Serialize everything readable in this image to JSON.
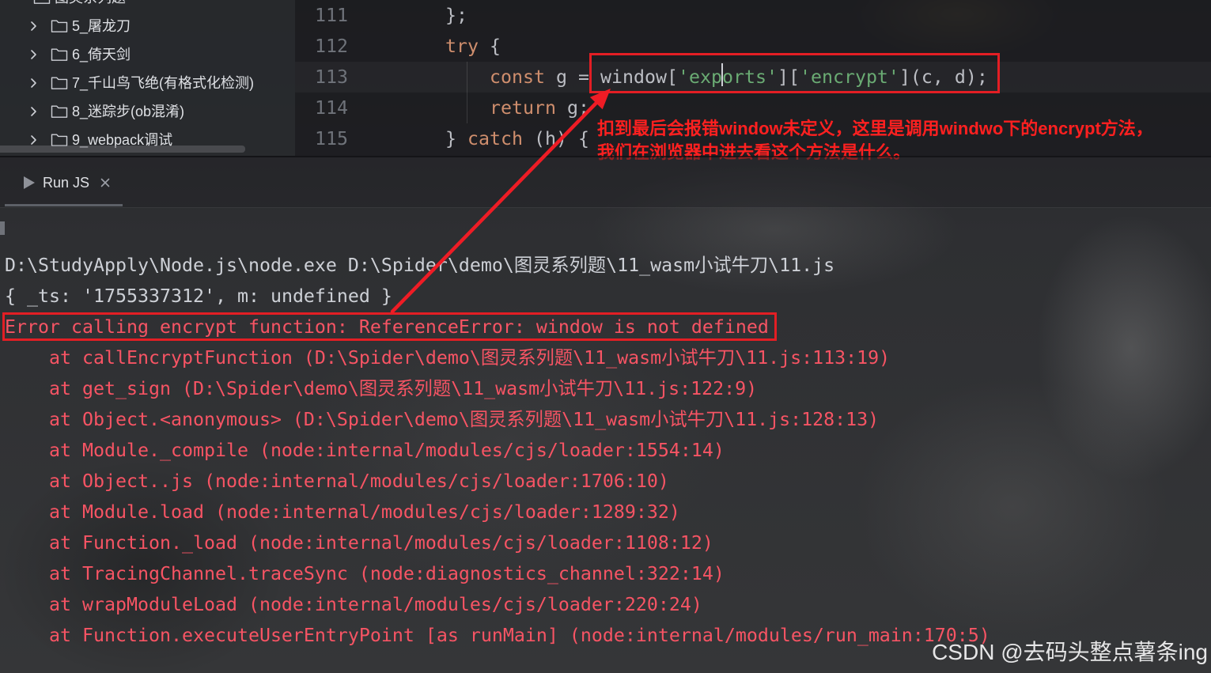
{
  "theme": {
    "editor_text": "#bcbec4",
    "keyword": "#cf8e6d",
    "string": "#6aab73",
    "line_number": "#6f737a",
    "console_text": "#cdd0d6",
    "console_error": "#f75464",
    "annotation_red": "#ff2020",
    "highlight_box_red": "#e31e24"
  },
  "project_tree": {
    "parent_label": "图灵系列题",
    "item_icon": "folder-icon",
    "items": [
      {
        "label": "5_屠龙刀"
      },
      {
        "label": "6_倚天剑"
      },
      {
        "label": "7_千山鸟飞绝(有格式化检测)"
      },
      {
        "label": "8_迷踪步(ob混淆)"
      },
      {
        "label": "9_webpack调试"
      }
    ]
  },
  "editor": {
    "lines": [
      {
        "number": "111",
        "tokens": [
          "};"
        ]
      },
      {
        "number": "112",
        "tokens": [
          "try",
          " {"
        ]
      },
      {
        "number": "113",
        "tokens": [
          "const",
          " g = ",
          "window[",
          "'exp",
          "orts'",
          "][",
          "'encrypt'",
          "](c, d);"
        ]
      },
      {
        "number": "114",
        "tokens": [
          "return",
          " g;"
        ]
      },
      {
        "number": "115",
        "tokens": [
          "} ",
          "catch",
          " (h) {"
        ]
      }
    ]
  },
  "annotation": {
    "lines": [
      "扣到最后会报错window未定义，这里是调用windwo下的encrypt方法，",
      "我们在浏览器中进去看这个方法是什么。"
    ]
  },
  "run_panel": {
    "tab_label": "Run JS",
    "tab_icon": "run-icon",
    "close_icon": "close-icon"
  },
  "console": {
    "command": "D:\\StudyApply\\Node.js\\node.exe D:\\Spider\\demo\\图灵系列题\\11_wasm小试牛刀\\11.js",
    "output": "{ _ts: '1755337312', m: undefined }",
    "error": "Error calling encrypt function: ReferenceError: window is not defined",
    "stack": [
      "at callEncryptFunction (D:\\Spider\\demo\\图灵系列题\\11_wasm小试牛刀\\11.js:113:19)",
      "at get_sign (D:\\Spider\\demo\\图灵系列题\\11_wasm小试牛刀\\11.js:122:9)",
      "at Object.<anonymous> (D:\\Spider\\demo\\图灵系列题\\11_wasm小试牛刀\\11.js:128:13)",
      "at Module._compile (node:internal/modules/cjs/loader:1554:14)",
      "at Object..js (node:internal/modules/cjs/loader:1706:10)",
      "at Module.load (node:internal/modules/cjs/loader:1289:32)",
      "at Function._load (node:internal/modules/cjs/loader:1108:12)",
      "at TracingChannel.traceSync (node:diagnostics_channel:322:14)",
      "at wrapModuleLoad (node:internal/modules/cjs/loader:220:24)",
      "at Function.executeUserEntryPoint [as runMain] (node:internal/modules/run_main:170:5)"
    ]
  },
  "watermark": "CSDN @去码头整点薯条ing"
}
